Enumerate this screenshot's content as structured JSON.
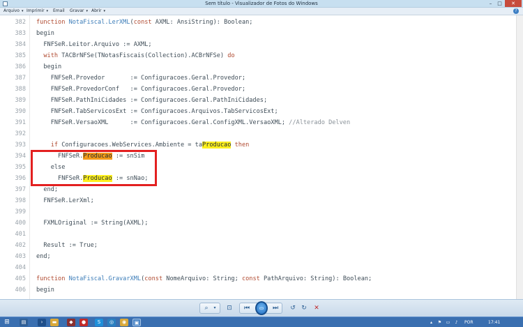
{
  "window": {
    "title": "Sem título - Visualizador de Fotos do Windows",
    "minimize_glyph": "–",
    "maximize_glyph": "□",
    "close_glyph": "✕"
  },
  "menu": {
    "items": [
      {
        "label": "Arquivo"
      },
      {
        "label": "Imprimir"
      },
      {
        "label": "Email"
      },
      {
        "label": "Gravar"
      },
      {
        "label": "Abrir"
      }
    ],
    "help_glyph": "?"
  },
  "code": {
    "lines": [
      {
        "num": "382"
      },
      {
        "num": "383"
      },
      {
        "num": "384"
      },
      {
        "num": "385"
      },
      {
        "num": "386"
      },
      {
        "num": "387"
      },
      {
        "num": "388"
      },
      {
        "num": "389"
      },
      {
        "num": "390"
      },
      {
        "num": "391"
      },
      {
        "num": "392"
      },
      {
        "num": "393"
      },
      {
        "num": "394"
      },
      {
        "num": "395"
      },
      {
        "num": "396"
      },
      {
        "num": "397"
      },
      {
        "num": "398"
      },
      {
        "num": "399"
      },
      {
        "num": "400"
      },
      {
        "num": "401"
      },
      {
        "num": "402"
      },
      {
        "num": "403"
      },
      {
        "num": "404"
      },
      {
        "num": "405"
      },
      {
        "num": "406"
      }
    ],
    "t": {
      "l382_a": "function ",
      "l382_b": "NotaFiscal.LerXML",
      "l382_c": "(",
      "l382_d": "const",
      "l382_e": " AXML: AnsiString): Boolean;",
      "l383": "begin",
      "l384": "  FNFSeR.Leitor.Arquivo := AXML;",
      "l385_a": "  with",
      "l385_b": " TACBrNFSe(TNotasFiscais(Collection).ACBrNFSe) ",
      "l385_c": "do",
      "l386": "  begin",
      "l387": "    FNFSeR.Provedor       := Configuracoes.Geral.Provedor;",
      "l388": "    FNFSeR.ProvedorConf   := Configuracoes.Geral.Provedor;",
      "l389": "    FNFSeR.PathIniCidades := Configuracoes.Geral.PathIniCidades;",
      "l390": "    FNFSeR.TabServicosExt := Configuracoes.Arquivos.TabServicosExt;",
      "l391_a": "    FNFSeR.VersaoXML      := Configuracoes.Geral.ConfigXML.VersaoXML; ",
      "l391_b": "//Alterado Delven",
      "l393_a": "    if",
      "l393_b": " Configuracoes.WebServices.Ambiente = ta",
      "l393_c": "Producao",
      "l393_d": " ",
      "l393_e": "then",
      "l394_a": "      FNFSeR.",
      "l394_b": "Producao",
      "l394_c": " := snSim",
      "l395": "    else",
      "l396_a": "      FNFSeR.",
      "l396_b": "Producao",
      "l396_c": " := snNao;",
      "l397": "  end;",
      "l398": "  FNFSeR.LerXml;",
      "l400": "  FXMLOriginal := String(AXML);",
      "l402": "  Result := True;",
      "l403": "end;",
      "l405_a": "function ",
      "l405_b": "NotaFiscal.GravarXML",
      "l405_c": "(",
      "l405_d": "const",
      "l405_e": " NomeArquivo: String; ",
      "l405_f": "const",
      "l405_g": " PathArquivo: String): Boolean;",
      "l406": "begin"
    }
  },
  "viewer_toolbar": {
    "zoom_glyph": "⌕",
    "zoom_caret": "▾",
    "fit_glyph": "⊡",
    "prev_glyph": "⏮",
    "slideshow_glyph": "▭",
    "next_glyph": "⏭",
    "rotate_ccw_glyph": "↺",
    "rotate_cw_glyph": "↻",
    "delete_glyph": "✕"
  },
  "taskbar": {
    "start_glyph": "⊞",
    "apps": [
      {
        "name": "server-manager",
        "glyph": "▤",
        "color": "#2f5f96"
      },
      {
        "name": "powershell",
        "glyph": "›",
        "color": "#1f4f8a"
      },
      {
        "name": "file-explorer",
        "glyph": "▬",
        "color": "#d9a93a"
      },
      {
        "name": "delphi",
        "glyph": "◆",
        "color": "#8a2f2f"
      },
      {
        "name": "stop",
        "glyph": "●",
        "color": "#c22a2a"
      },
      {
        "name": "skype",
        "glyph": "S",
        "color": "#1f8fd9"
      },
      {
        "name": "browser",
        "glyph": "◎",
        "color": "#2a7fc0"
      },
      {
        "name": "chrome",
        "glyph": "◉",
        "color": "#d9a93a"
      },
      {
        "name": "photo-viewer",
        "glyph": "▣",
        "color": "#4c86c6"
      }
    ],
    "tray": {
      "language": "POR",
      "time": "17:41"
    }
  },
  "colors": {
    "highlight_orange": "#f29a1a",
    "highlight_yellow": "#ffef1f",
    "annotation_red": "#e32020",
    "keyword": "#b04a30",
    "function_name": "#3b7cb8"
  }
}
